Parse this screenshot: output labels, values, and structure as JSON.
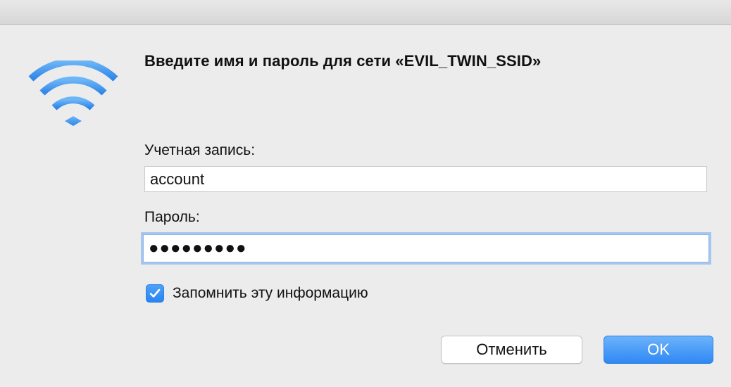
{
  "dialog": {
    "title": "Введите имя и пароль для сети «EVIL_TWIN_SSID»",
    "icon": "wifi-icon",
    "accent_color": "#3a8ee6"
  },
  "form": {
    "account_label": "Учетная запись:",
    "account_value": "account",
    "password_label": "Пароль:",
    "password_value": "●●●●●●●●●",
    "remember_label": "Запомнить эту информацию",
    "remember_checked": true
  },
  "buttons": {
    "cancel_label": "Отменить",
    "ok_label": "OK"
  }
}
